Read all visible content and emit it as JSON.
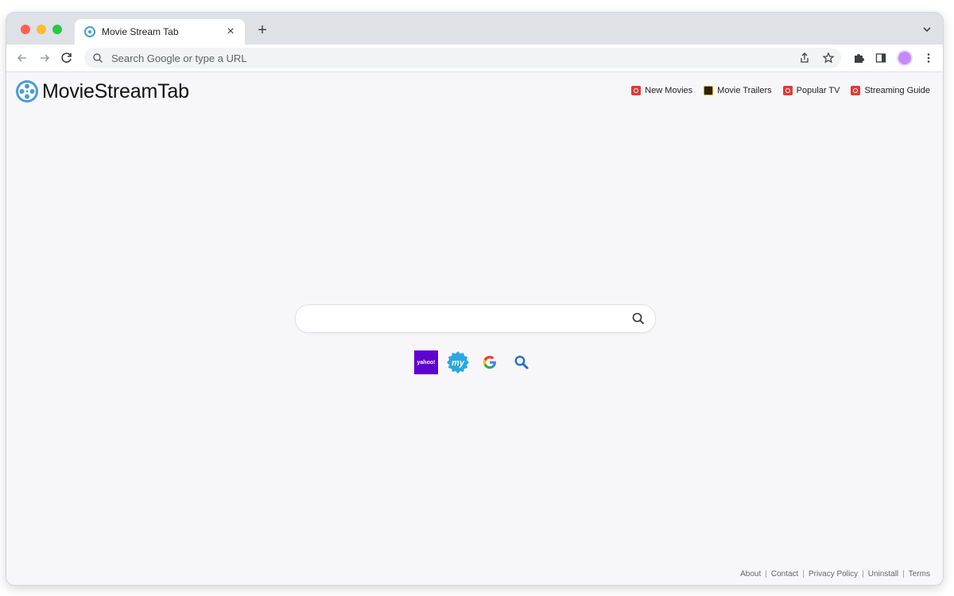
{
  "browser": {
    "tab_title": "Movie Stream Tab",
    "new_tab_label": "+",
    "omnibox_placeholder": "Search Google or type a URL"
  },
  "site": {
    "brand_name": "MovieStreamTab"
  },
  "header_links": [
    {
      "label": "New Movies",
      "icon": "red-film-icon"
    },
    {
      "label": "Movie Trailers",
      "icon": "imdb-icon"
    },
    {
      "label": "Popular TV",
      "icon": "red-tv-icon"
    },
    {
      "label": "Streaming Guide",
      "icon": "red-grid-icon"
    }
  ],
  "search": {
    "placeholder": "",
    "engines": [
      {
        "name": "yahoo",
        "label": "yahoo!"
      },
      {
        "name": "my",
        "label": "my"
      },
      {
        "name": "google",
        "label": "G"
      },
      {
        "name": "search",
        "label": ""
      }
    ]
  },
  "footer": {
    "links": [
      "About",
      "Contact",
      "Privacy Policy",
      "Uninstall",
      "Terms"
    ]
  },
  "colors": {
    "accent": "#4a9bd4",
    "yahoo": "#5f01d1"
  }
}
